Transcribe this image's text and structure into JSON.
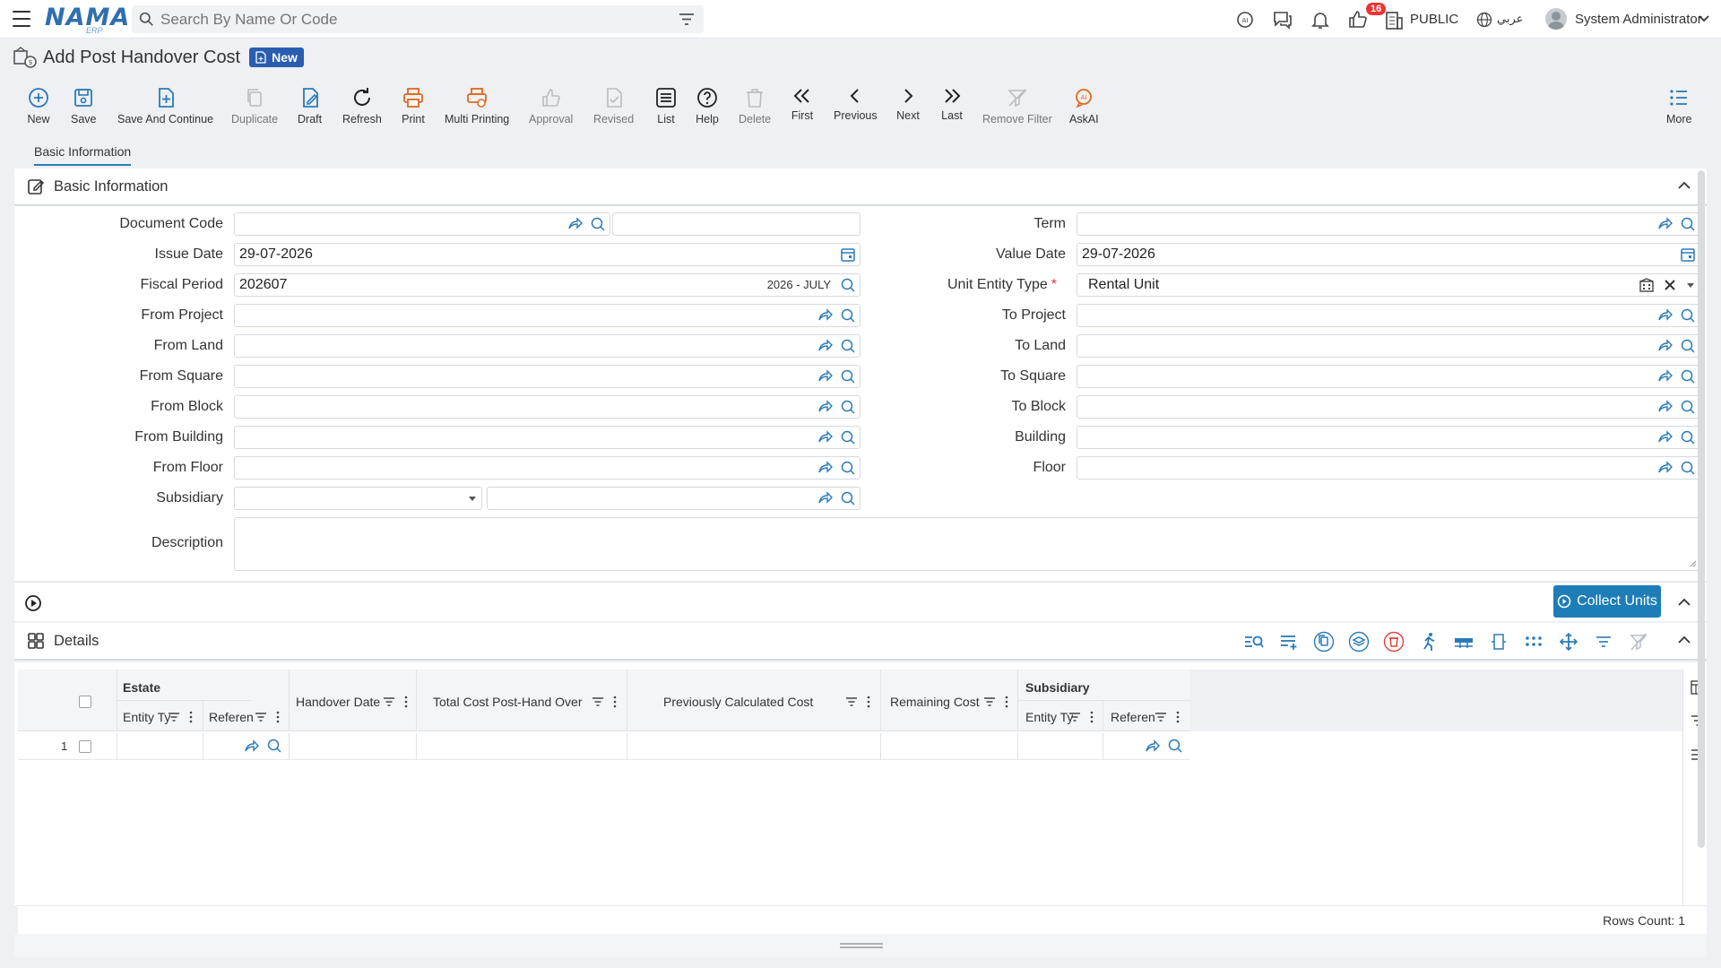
{
  "topbar": {
    "logo_text": "NAMA",
    "logo_sub": "ERP",
    "search_placeholder": "Search By Name Or Code",
    "notifications_count": "16",
    "public_label": "PUBLIC",
    "language_label": "عربي",
    "user_name": "System Administrator"
  },
  "page": {
    "title": "Add Post Handover Cost",
    "status_badge": "New"
  },
  "toolbar": {
    "new": "New",
    "save": "Save",
    "save_continue": "Save And Continue",
    "duplicate": "Duplicate",
    "draft": "Draft",
    "refresh": "Refresh",
    "print": "Print",
    "multi_printing": "Multi Printing",
    "approval": "Approval",
    "revised": "Revised",
    "list": "List",
    "help": "Help",
    "delete": "Delete",
    "first": "First",
    "previous": "Previous",
    "next": "Next",
    "last": "Last",
    "remove_filter": "Remove Filter",
    "askai": "AskAI",
    "more": "More"
  },
  "tabs": {
    "basic_information": "Basic Information"
  },
  "basic_panel": {
    "title": "Basic Information"
  },
  "form": {
    "document_code": {
      "label": "Document Code",
      "value": ""
    },
    "issue_date": {
      "label": "Issue Date",
      "value": "29-07-2026"
    },
    "fiscal_period": {
      "label": "Fiscal Period",
      "value": "202607",
      "hint": "2026 - JULY"
    },
    "from_project": {
      "label": "From Project",
      "value": ""
    },
    "from_land": {
      "label": "From Land",
      "value": ""
    },
    "from_square": {
      "label": "From Square",
      "value": ""
    },
    "from_block": {
      "label": "From Block",
      "value": ""
    },
    "from_building": {
      "label": "From Building",
      "value": ""
    },
    "from_floor": {
      "label": "From Floor",
      "value": ""
    },
    "subsidiary": {
      "label": "Subsidiary",
      "value": ""
    },
    "description": {
      "label": "Description",
      "value": ""
    },
    "term": {
      "label": "Term",
      "value": ""
    },
    "value_date": {
      "label": "Value Date",
      "value": "29-07-2026"
    },
    "unit_entity_type": {
      "label": "Unit Entity Type",
      "required_mark": "*",
      "value": "Rental Unit"
    },
    "to_project": {
      "label": "To Project",
      "value": ""
    },
    "to_land": {
      "label": "To Land",
      "value": ""
    },
    "to_square": {
      "label": "To Square",
      "value": ""
    },
    "to_block": {
      "label": "To Block",
      "value": ""
    },
    "building": {
      "label": "Building",
      "value": ""
    },
    "floor": {
      "label": "Floor",
      "value": ""
    }
  },
  "collect_units_label": "Collect Units",
  "details_panel": {
    "title": "Details"
  },
  "grid": {
    "group_estate": "Estate",
    "col_entity_type": "Entity Ty",
    "col_reference": "Referen",
    "col_handover_date": "Handover Date",
    "col_total_cost": "Total Cost Post-Hand Over",
    "col_prev_calc_cost": "Previously Calculated Cost",
    "col_remaining_cost": "Remaining Cost",
    "group_subsidiary": "Subsidiary",
    "col_sub_entity_type": "Entity Ty",
    "col_sub_reference": "Referen",
    "rows": [
      {
        "index": "1"
      }
    ],
    "rows_count": "Rows Count: 1"
  }
}
